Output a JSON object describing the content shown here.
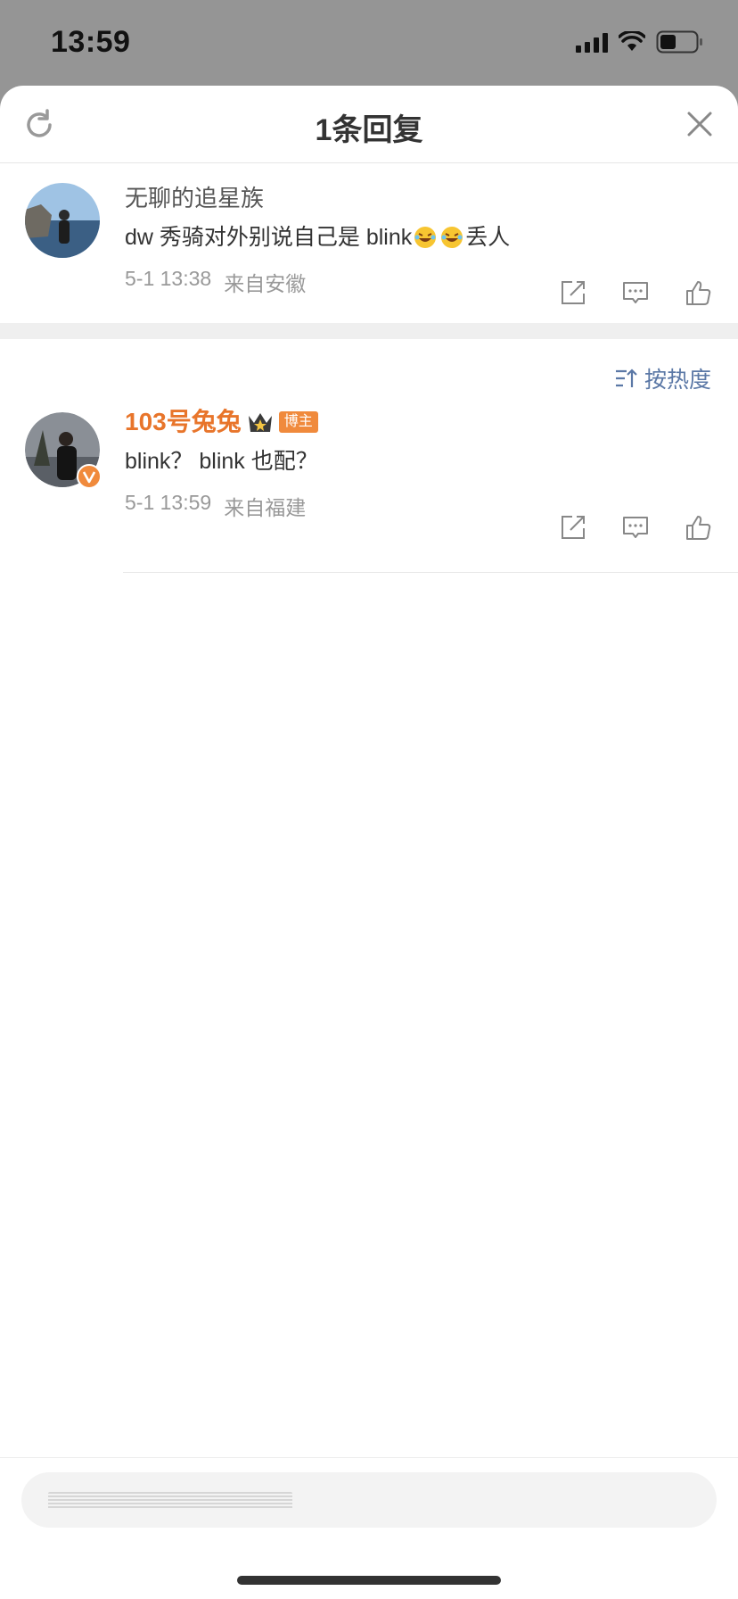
{
  "status": {
    "time": "13:59"
  },
  "header": {
    "title": "1条回复"
  },
  "root_comment": {
    "username": "无聊的追星族",
    "text_before": "dw 秀骑对外别说自己是 blink",
    "text_after": "丢人",
    "emoji": [
      "laughing-crying-emoji",
      "laughing-crying-emoji"
    ],
    "timestamp": "5-1 13:38",
    "location": "来自安徽"
  },
  "sort": {
    "label": "按热度"
  },
  "reply": {
    "username": "103号兔兔",
    "badge": "博主",
    "text": "blink？ blink 也配？",
    "timestamp": "5-1 13:59",
    "location": "来自福建"
  },
  "colors": {
    "accent_orange": "#e8752b",
    "sort_blue": "#5b78a6",
    "badge_orange": "#f08a3c"
  }
}
